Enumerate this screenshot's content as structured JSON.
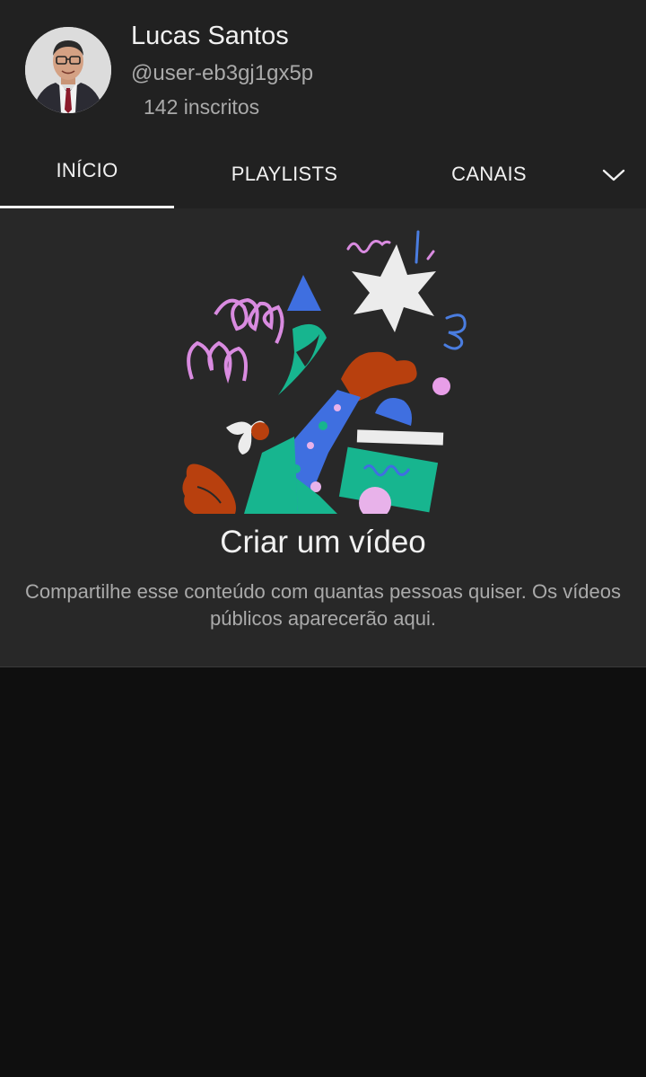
{
  "channel": {
    "name": "Lucas Santos",
    "handle": "@user-eb3gj1gx5p",
    "subscribers": "142 inscritos"
  },
  "tabs": [
    {
      "label": "INÍCIO",
      "selected": true
    },
    {
      "label": "PLAYLISTS",
      "selected": false
    },
    {
      "label": "CANAIS",
      "selected": false
    }
  ],
  "tab_more_icon": "chevron-down-icon",
  "empty_state": {
    "title": "Criar um vídeo",
    "description": "Compartilhe esse conteúdo com quantas pessoas quiser. Os vídeos públicos aparecerão aqui."
  },
  "colors": {
    "background": "#0f0f0f",
    "surface": "#212121",
    "empty_surface": "#282828",
    "text_primary": "#f1f1f1",
    "text_secondary": "#aaaaaa"
  }
}
